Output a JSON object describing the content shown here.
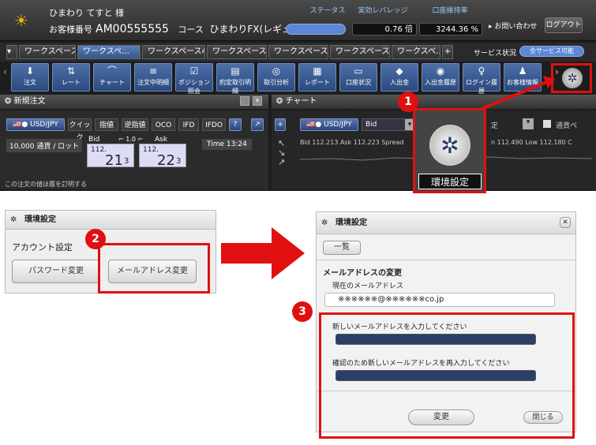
{
  "header": {
    "user_name": "ひまわり てすと 様",
    "customer_label": "お客様番号",
    "customer_no": "AM00555555",
    "course_label": "コース",
    "course": "ひまわりFX(レギュラー)",
    "status_label": "ステータス",
    "leverage_label": "実効レバレッジ",
    "leverage": "0.76 倍",
    "maintenance_label": "口座維持率",
    "maintenance": "3244.36 %",
    "inquiry": "▸ お問い合わせ",
    "logout": "ログアウト",
    "service_label": "サービス状況",
    "service_status": "全サービス可能"
  },
  "tabs": [
    "ワークスペース",
    "ワークスペ…",
    "ワークスペース4",
    "ワークスペース6",
    "ワークスペース5",
    "ワークスペース7",
    "ワークスペ…"
  ],
  "toolbar": [
    {
      "icon": "⬇",
      "label": "注文"
    },
    {
      "icon": "⇅",
      "label": "レート"
    },
    {
      "icon": "⌒",
      "label": "チャート"
    },
    {
      "icon": "≡",
      "label": "注文中明細"
    },
    {
      "icon": "☑",
      "label": "ポジション照会"
    },
    {
      "icon": "▤",
      "label": "約定取引明細"
    },
    {
      "icon": "◎",
      "label": "取引分析"
    },
    {
      "icon": "▦",
      "label": "レポート"
    },
    {
      "icon": "▭",
      "label": "口座状況"
    },
    {
      "icon": "◆",
      "label": "入出金"
    },
    {
      "icon": "◉",
      "label": "入出金履歴"
    },
    {
      "icon": "♀",
      "label": "ログイン履歴"
    },
    {
      "icon": "♟",
      "label": "お客様情報"
    }
  ],
  "order_panel": {
    "title": "新規注文",
    "pair": "USD/JPY",
    "types": [
      "クイック",
      "指値",
      "逆指値",
      "OCO",
      "IFD",
      "IFDO"
    ],
    "lot": "10,000 通貨 / ロット",
    "bid_label": "Bid",
    "ask_label": "Ask",
    "spread": "⌐ 1.0 ⌐",
    "time": "Time 13:24",
    "bid_big": "112.",
    "bid_main": "21",
    "bid_sub": "3",
    "ask_big": "112.",
    "ask_main": "22",
    "ask_sub": "3",
    "footer": "この注文の値ほ履を訂明する"
  },
  "chart_panel": {
    "title": "チャート",
    "pair": "USD/JPY",
    "side": "Bid",
    "info": "Bid 112.213 Ask 112.223 Spread",
    "info2": "n 112.490 Low 112.180 C",
    "suffix": "定",
    "check": "通貨ペ"
  },
  "callout": {
    "num": "1",
    "label": "環境設定"
  },
  "settings_small": {
    "title": "環境設定",
    "account_label": "アカウント設定",
    "password_btn": "パスワード変更",
    "email_btn": "メールアドレス変更",
    "num": "2"
  },
  "settings_big": {
    "title": "環境設定",
    "list_btn": "一覧",
    "section": "メールアドレスの変更",
    "current_label": "現在のメールアドレス",
    "current_value": "※※※※※※@※※※※※※co.jp",
    "new_label": "新しいメールアドレスを入力してください",
    "confirm_label": "確認のため新しいメールアドレスを再入力してください",
    "change_btn": "変更",
    "close_btn": "閉じる",
    "close_x": "✕",
    "num": "3"
  }
}
